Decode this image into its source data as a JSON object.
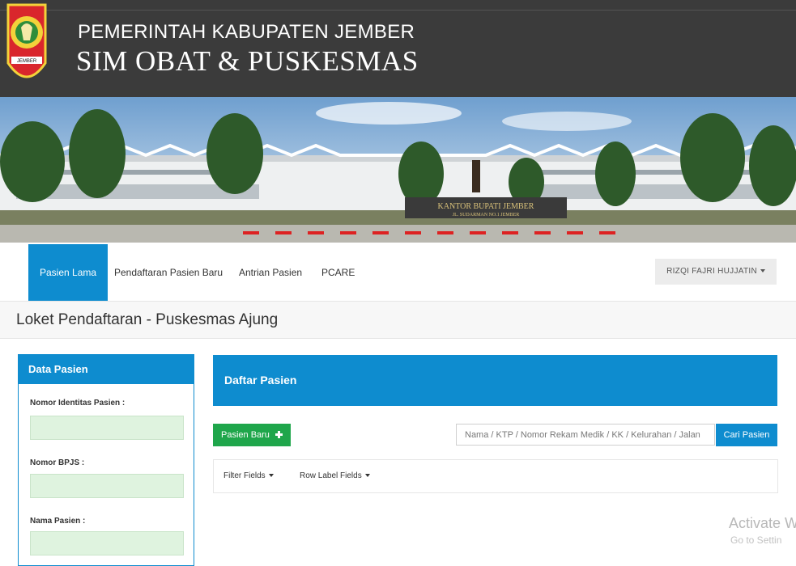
{
  "header": {
    "line1": "PEMERINTAH KABUPATEN JEMBER",
    "line2": "SIM OBAT & PUSKESMAS",
    "logo_text": "JEMBER"
  },
  "banner": {
    "sign_line1": "KANTOR BUPATI JEMBER",
    "sign_line2": "JL. SUDARMAN NO.1 JEMBER"
  },
  "nav": {
    "items": [
      {
        "label": "Pasien Lama",
        "active": true
      },
      {
        "label": "Pendaftaran Pasien Baru"
      },
      {
        "label": "Antrian Pasien"
      },
      {
        "label": "PCARE"
      }
    ],
    "user": "RIZQI FAJRI HUJJATIN"
  },
  "page": {
    "title": "Loket Pendaftaran - Puskesmas Ajung"
  },
  "left_panel": {
    "title": "Data Pasien",
    "fields": [
      {
        "label": "Nomor Identitas Pasien :",
        "value": ""
      },
      {
        "label": "Nomor BPJS :",
        "value": ""
      },
      {
        "label": "Nama Pasien :",
        "value": ""
      }
    ]
  },
  "right_panel": {
    "title": "Daftar Pasien",
    "new_button": "Pasien Baru",
    "search_placeholder": "Nama / KTP / Nomor Rekam Medik / KK / Kelurahan / Jalan",
    "search_button": "Cari Pasien",
    "filter_fields": "Filter Fields",
    "row_label_fields": "Row Label Fields"
  },
  "watermark": {
    "line1": "Activate W",
    "line2": "Go to Settin"
  },
  "colors": {
    "primary": "#0e8ccf",
    "success": "#1fa64b",
    "header_bg": "#3b3b3b",
    "input_bg": "#dff3df"
  },
  "icons": {
    "new_button": "plus-icon",
    "user_menu": "caret-down-icon"
  }
}
